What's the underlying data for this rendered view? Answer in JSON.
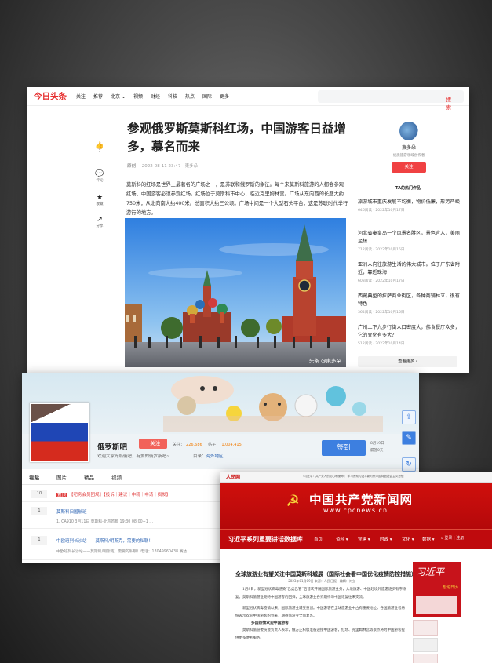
{
  "toutiao": {
    "logo": "今日头条",
    "nav": [
      "关注",
      "推荐",
      "北京 ⌄",
      "视频",
      "财经",
      "科技",
      "热点",
      "国际",
      "更多"
    ],
    "search_label": "搜索",
    "side": [
      {
        "icon": "thumbs-up-icon",
        "glyph": "👍",
        "label": "7"
      },
      {
        "icon": "comment-icon",
        "glyph": "💬",
        "label": "评论"
      },
      {
        "icon": "star-icon",
        "glyph": "★",
        "label": "收藏"
      },
      {
        "icon": "share-icon",
        "glyph": "↗",
        "label": "分享"
      }
    ],
    "title": "参观俄罗斯莫斯科红场，中国游客日益增多，慕名而来",
    "meta_tag": "原创",
    "meta_date": "2022-08-11 23:47",
    "meta_author": "東多朵",
    "paragraph": "莫斯科的红场是世界上最著名的广场之一，是苏联和俄罗斯的象征。每个来莫斯科旅游的人都会参观红场，中国游客必须参观红场。红场位于莫斯科市中心，临近克里姆林宫。广场从东向西的长度大约750米，从北向南大约400米。总面积大约三公顷。广场中间是一个大型石头平台，这是苏联时代举行游行的地方。",
    "watermark": "头条 @東多朵",
    "author": {
      "name": "東多朵",
      "desc": "优质旅游领域创作者",
      "follow": "关注"
    },
    "hot_title": "TA的热门作品",
    "hot": [
      {
        "title": "旅游城市重庆发展不均衡，物价低廉，形势严峻",
        "meta": "646阅读 · 2022年10月17日"
      },
      {
        "title": "河北省秦皇岛一个风景名胜区，景色宜人，美丽至极",
        "meta": "712阅读 · 2022年10月15日"
      },
      {
        "title": "亚洲人向往旅游生活的伟大城市。位于广东省附近，靠近珠海",
        "meta": "603阅读 · 2022年10月17日"
      },
      {
        "title": "西藏典型的拉萨商业街区，各种商铺林立，很有特色",
        "meta": "364阅读 · 2022年10月15日"
      },
      {
        "title": "广州上下九步行街人口密度大，佛食餐厅众多，它的变化有多大？",
        "meta": "512阅读 · 2022年10月14日"
      }
    ],
    "more": "查看更多 ›"
  },
  "tieba": {
    "name": "俄罗斯吧",
    "follow": "+关注",
    "stats_label_1": "关注：",
    "stats_value_1": "226,686",
    "stats_label_2": "帖子：",
    "stats_value_2": "1,004,415",
    "slogan": "欢迎大家光临俄吧，有爱的俄罗斯吧~",
    "category_label": "目录：",
    "category": "海外地区",
    "sign": "签到",
    "sign_date_1": "8月19日",
    "sign_date_2": "漏签0天",
    "tabs": [
      "看贴",
      "图片",
      "精品",
      "视频"
    ],
    "rows": [
      {
        "count": "10",
        "top": "置顶",
        "title": "【吧务会员团规】【投诉｜建议｜申精｜申请｜揭发】",
        "meta": ""
      },
      {
        "count": "1",
        "top": "",
        "title": "莫斯科旧国航班",
        "meta": "1. CA910 3月11日 莫斯科-北京首都 19:30 08:00+1 …"
      },
      {
        "count": "1",
        "top": "",
        "title": "中欧班列长沙站——莫斯科/明斯克，需要的私聊！",
        "meta": "中欧班列长沙站——莫斯科/明斯克，需要的私聊！电话：13049960438 赛达…"
      }
    ]
  },
  "cpc": {
    "top_logo": "人民网",
    "top_text": "『习近平：共产党人的初心和使命』  学习贯彻习近平新时代中国特色社会主义思想",
    "emblem": "☭",
    "name": "中国共产党新闻网",
    "url": "www.cpcnews.cn",
    "nav_lead": "习近平系列重要讲话数据库",
    "nav": [
      "首页",
      "资料 ▾",
      "党建 ▾",
      "时政 ▾",
      "文化 ▾",
      "数据 ▾"
    ],
    "search": "⌕ 登录 | 注册",
    "article_title": "全球旅游业有望关注中国莫斯科城展（国际社会看中国优化疫情防控措施）",
    "article_source": "2023年01月09日 来源：人民日报 · 编辑：刘立",
    "article_p1": "1月8日，新型冠状病毒感染“乙类乙管”后首次开展国际旅游业务，入境旅游、中国赴境外旅游逐步有序恢复。莫斯科旅游业期待中国游客的回归，全球旅游业各界期待与中国恢复往来交流。",
    "article_p2": "新型冠状病毒疫情以来，国际旅游业遭受重创。中国游客在全球旅游业中占有重要地位，各国旅游业者纷纷表示欢迎中国游客的到来，期待旅游业全面复苏。",
    "subhead": "多国热情欢迎中国游客",
    "article_p3": "莫斯科旅游委员会负责人表示，俄方正积极准备迎接中国游客，红场、克里姆林宫等景点将为中国游客提供更多便利服务。",
    "side_title": "习近平",
    "side_sub": "想论日历"
  }
}
